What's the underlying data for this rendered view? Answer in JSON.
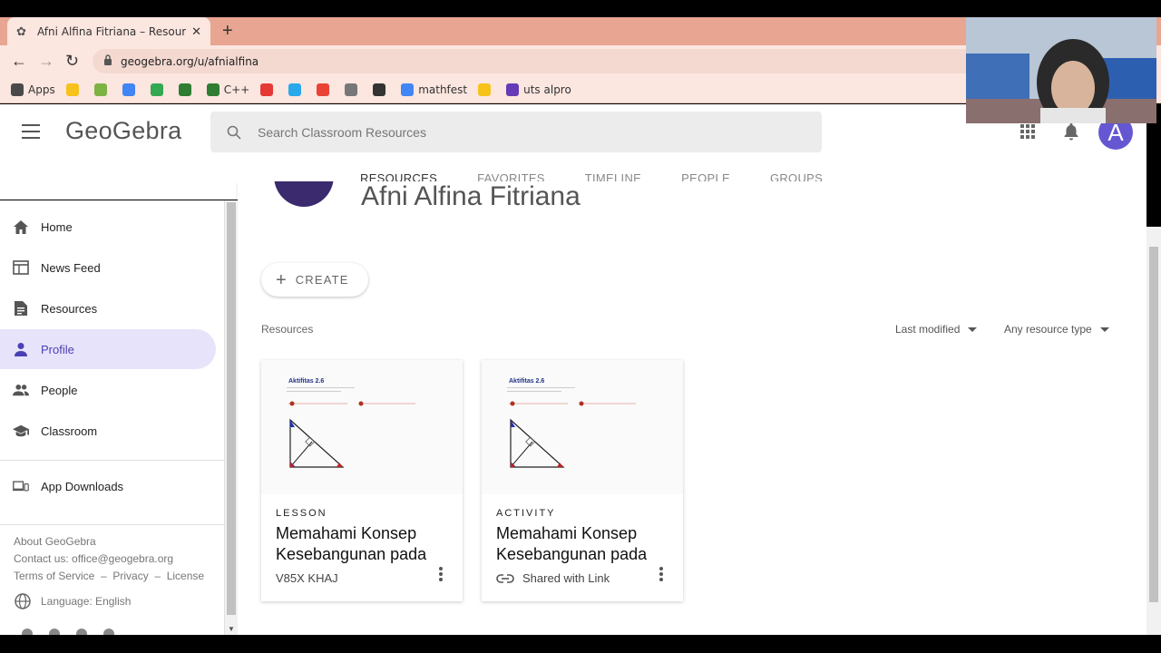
{
  "browser": {
    "tab_title": "Afni Alfina Fitriana – Resources – GeoGebra",
    "url": "geogebra.org/u/afnialfina",
    "bookmarks": [
      {
        "label": "Apps",
        "color": "#4a4a4a"
      },
      {
        "label": "",
        "color": "#f6c21b"
      },
      {
        "label": "",
        "color": "#7cb342"
      },
      {
        "label": "",
        "color": "#4285f4"
      },
      {
        "label": "",
        "color": "#34a853"
      },
      {
        "label": "",
        "color": "#2e7d32"
      },
      {
        "label": "C++",
        "color": "#2e7d32"
      },
      {
        "label": "",
        "color": "#e53935"
      },
      {
        "label": "",
        "color": "#29a9eb"
      },
      {
        "label": "",
        "color": "#ea4335"
      },
      {
        "label": "",
        "color": "#777777"
      },
      {
        "label": "",
        "color": "#333333"
      },
      {
        "label": "mathfest",
        "color": "#4285f4"
      },
      {
        "label": "",
        "color": "#f6c21b"
      },
      {
        "label": "uts alpro",
        "color": "#673ab7"
      }
    ]
  },
  "header": {
    "logo": "GeoGebra",
    "search_placeholder": "Search Classroom Resources",
    "avatar_letter": "A",
    "tabs": [
      "RESOURCES",
      "FAVORITES",
      "TIMELINE",
      "PEOPLE",
      "GROUPS"
    ],
    "active_tab": 0
  },
  "profile": {
    "name": "Afni Alfina Fitriana"
  },
  "sidebar": {
    "items": [
      {
        "label": "Home",
        "icon": "home-icon"
      },
      {
        "label": "News Feed",
        "icon": "news-feed-icon"
      },
      {
        "label": "Resources",
        "icon": "resources-icon"
      },
      {
        "label": "Profile",
        "icon": "profile-icon"
      },
      {
        "label": "People",
        "icon": "people-icon"
      },
      {
        "label": "Classroom",
        "icon": "classroom-icon"
      }
    ],
    "active_index": 3,
    "app_downloads": "App Downloads",
    "about": "About GeoGebra",
    "contact": "Contact us: office@geogebra.org",
    "legal": "Terms of Service  –  Privacy  –  License",
    "language": "Language: English"
  },
  "main": {
    "create_label": "CREATE",
    "resources_label": "Resources",
    "sort_label": "Last modified",
    "type_filter": "Any resource type",
    "cards": [
      {
        "type": "LESSON",
        "title": "Memahami Konsep Kesebangunan pada",
        "subtitle": "V85X KHAJ",
        "shared": false,
        "thumb_title": "Aktifitas 2.6"
      },
      {
        "type": "ACTIVITY",
        "title": "Memahami Konsep Kesebangunan pada",
        "subtitle": "Shared with Link",
        "shared": true,
        "thumb_title": "Aktifitas 2.6"
      }
    ]
  },
  "colors": {
    "accent": "#6557d2",
    "active_bg": "#e7e3fa",
    "chrome_tab": "#e8a591"
  }
}
